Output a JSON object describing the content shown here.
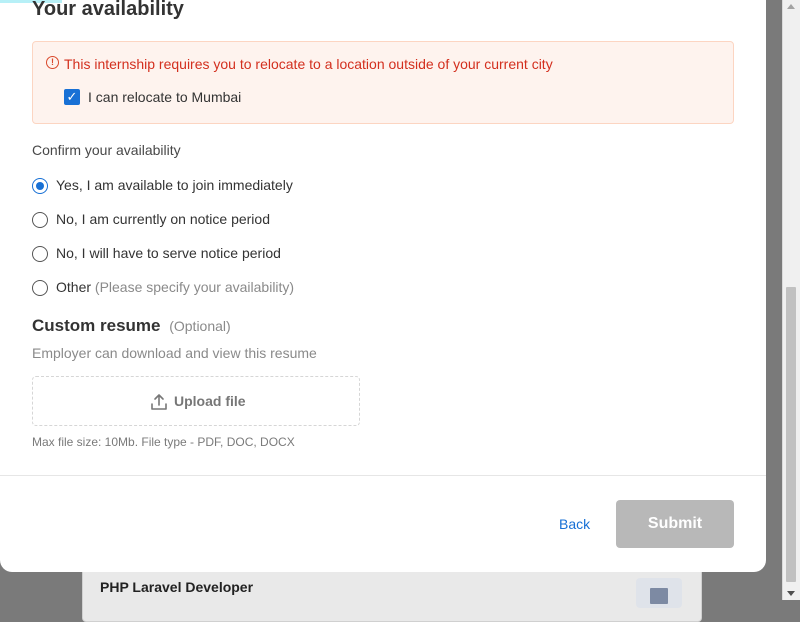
{
  "background": {
    "card_title": "PHP Laravel Developer"
  },
  "availability": {
    "title": "Your availability",
    "alert": {
      "icon": "alert-circle-icon",
      "message": "This internship requires you to relocate to a location outside of your current city",
      "checkbox_label": "I can relocate to Mumbai",
      "checkbox_checked": true
    },
    "confirm_label": "Confirm your availability",
    "options": [
      {
        "label": "Yes, I am available to join immediately",
        "hint": "",
        "selected": true
      },
      {
        "label": "No, I am currently on notice period",
        "hint": "",
        "selected": false
      },
      {
        "label": "No, I will have to serve notice period",
        "hint": "",
        "selected": false
      },
      {
        "label": "Other",
        "hint": "(Please specify your availability)",
        "selected": false
      }
    ]
  },
  "resume": {
    "title": "Custom resume",
    "optional": "(Optional)",
    "description": "Employer can download and view this resume",
    "upload_label": "Upload file",
    "upload_icon": "upload-icon",
    "file_hint": "Max file size: 10Mb. File type - PDF, DOC, DOCX"
  },
  "footer": {
    "back_label": "Back",
    "submit_label": "Submit"
  },
  "colors": {
    "accent": "#1870d5",
    "alert_text": "#d32f1e",
    "alert_bg": "#fef3ee",
    "submit_disabled": "#b8b8b8"
  }
}
